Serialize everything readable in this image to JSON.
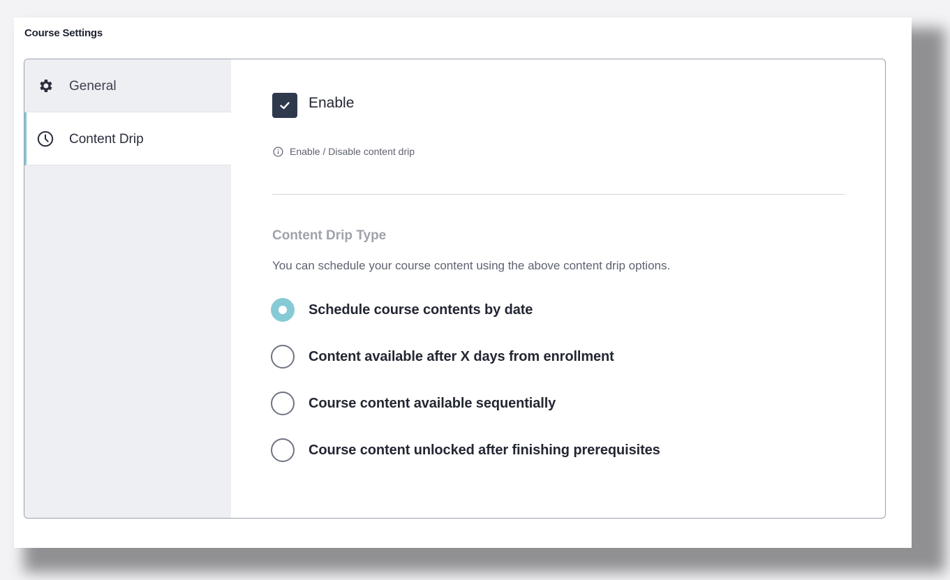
{
  "page": {
    "title": "Course Settings"
  },
  "sidebar": {
    "items": [
      {
        "label": "General",
        "icon": "gear-icon",
        "active": false
      },
      {
        "label": "Content Drip",
        "icon": "clock-icon",
        "active": true
      }
    ]
  },
  "content_drip": {
    "enable_label": "Enable",
    "enable_checked": true,
    "help_text": "Enable / Disable content drip",
    "section_title": "Content Drip Type",
    "section_description": "You can schedule your course content using the above content drip options.",
    "options": [
      {
        "label": "Schedule course contents by date",
        "selected": true
      },
      {
        "label": "Content available after X days from enrollment",
        "selected": false
      },
      {
        "label": "Course content available sequentially",
        "selected": false
      },
      {
        "label": "Course content unlocked after finishing prerequisites",
        "selected": false
      }
    ]
  },
  "colors": {
    "accent": "#86cad5",
    "checkbox": "#2f394e",
    "sidebar_bg": "#eeeff3",
    "border": "#9aa0ad"
  }
}
